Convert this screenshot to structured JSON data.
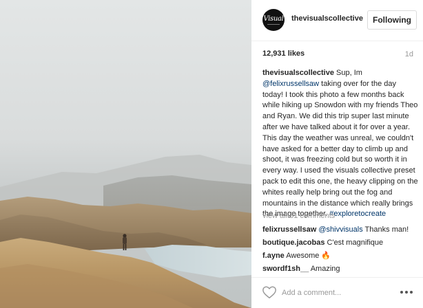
{
  "post": {
    "image_alt": "hiker on foggy hillside"
  },
  "header": {
    "avatar_text": "Visual",
    "username": "thevisualscollective",
    "follow_label": "Following"
  },
  "stats": {
    "likes": "12,931 likes",
    "time": "1d"
  },
  "caption": {
    "author": "thevisualscollective",
    "intro": " Sup, Im ",
    "mention": "@felixrussellsaw",
    "body": " taking over for the day today! I took this photo a few months back while hiking up Snowdon with my friends Theo and Ryan. We did this trip super last minute after we have talked about it for over a year. This day the weather was unreal, we couldn't have asked for a better day to climb up and shoot, it was freezing cold but so worth it in every way. I used the visuals collective preset pack to edit this one, the heavy clipping on the whites really help bring out the fog and mountains in the distance which really brings the image together. ",
    "hashtag": "#exploretocreate"
  },
  "view_all_comments": "view all 81 comments",
  "comments": [
    {
      "author": "felixrussellsaw",
      "mention": "@shivvisuals",
      "text": " Thanks man!"
    },
    {
      "author": "boutique.jacobas",
      "mention": "",
      "text": " C'est magnifique"
    },
    {
      "author": "f.ayne",
      "mention": "",
      "text": " Awesome 🔥"
    },
    {
      "author": "swordf1sh__",
      "mention": "",
      "text": " Amazing"
    }
  ],
  "footer": {
    "add_comment_placeholder": "Add a comment..."
  },
  "colors": {
    "link": "#003569",
    "muted": "#999999",
    "text": "#262626"
  }
}
